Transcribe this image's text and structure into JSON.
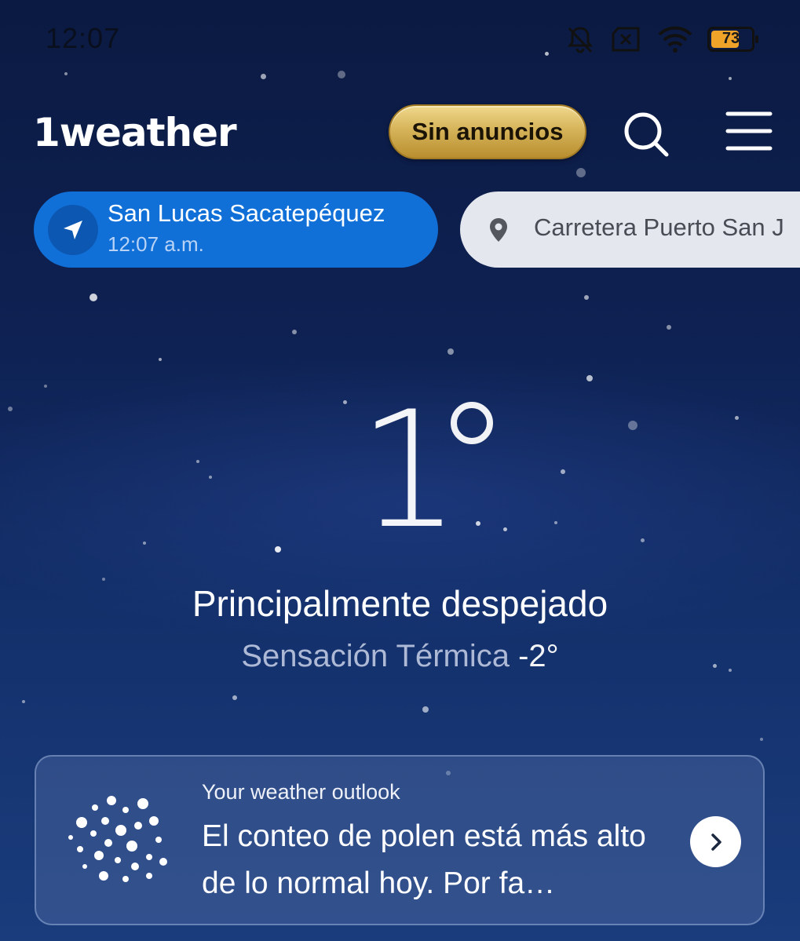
{
  "status_bar": {
    "time": "12:07",
    "battery_level": 73,
    "battery_label": "73",
    "icons": [
      "mute-icon",
      "sim-error-icon",
      "wifi-icon",
      "battery-icon"
    ]
  },
  "header": {
    "logo_text": "1weather",
    "ads_button_label": "Sin anuncios",
    "icons": [
      "search-icon",
      "menu-icon"
    ]
  },
  "locations": [
    {
      "name": "San Lucas Sacatepéquez",
      "time": "12:07 a.m.",
      "selected": true,
      "icon": "navigation-arrow-icon"
    },
    {
      "name": "Carretera Puerto San J",
      "selected": false,
      "icon": "location-pin-icon"
    }
  ],
  "current": {
    "temperature": "1",
    "condition": "Principalmente despejado",
    "feels_like_label": "Sensación Térmica",
    "feels_like_value": "-2°"
  },
  "outlook": {
    "label": "Your weather outlook",
    "message": "El conteo de polen está más alto de lo normal hoy. Por fa…",
    "icon": "pollen-icon",
    "arrow_icon": "chevron-right-icon"
  },
  "colors": {
    "background_top": "#0b1a42",
    "background_bottom": "#1a3c7c",
    "selected_chip": "#1170d8",
    "unselected_chip": "#e4e7ee",
    "ads_button_gold": "#d6b45a",
    "battery_fill": "#f0a329"
  }
}
